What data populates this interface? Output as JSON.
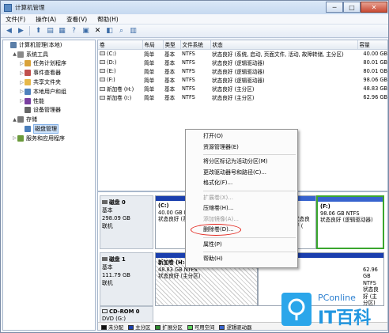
{
  "window": {
    "title": "计算机管理"
  },
  "menu": [
    "文件(F)",
    "操作(A)",
    "查看(V)",
    "帮助(H)"
  ],
  "toolbar": {
    "icons": [
      "back-icon",
      "forward-icon",
      "up-icon",
      "show-tree-icon",
      "properties-icon",
      "help-icon",
      "refresh-icon",
      "delete-icon",
      "export-icon",
      "search-icon",
      "settings-icon"
    ]
  },
  "tree": [
    {
      "label": "计算机管理(本地)",
      "indent": 0,
      "icon": "computer-icon",
      "expand": ""
    },
    {
      "label": "系统工具",
      "indent": 1,
      "icon": "tools-icon",
      "expand": "▲"
    },
    {
      "label": "任务计划程序",
      "indent": 2,
      "icon": "clock-icon",
      "expand": "▷"
    },
    {
      "label": "事件查看器",
      "indent": 2,
      "icon": "event-icon",
      "expand": "▷"
    },
    {
      "label": "共享文件夹",
      "indent": 2,
      "icon": "folder-icon",
      "expand": "▷"
    },
    {
      "label": "本地用户和组",
      "indent": 2,
      "icon": "users-icon",
      "expand": "▷"
    },
    {
      "label": "性能",
      "indent": 2,
      "icon": "performance-icon",
      "expand": "▷"
    },
    {
      "label": "设备管理器",
      "indent": 2,
      "icon": "device-icon",
      "expand": ""
    },
    {
      "label": "存储",
      "indent": 1,
      "icon": "storage-icon",
      "expand": "▲"
    },
    {
      "label": "磁盘管理",
      "indent": 2,
      "icon": "disk-icon",
      "expand": "",
      "selected": true
    },
    {
      "label": "服务和应用程序",
      "indent": 1,
      "icon": "services-icon",
      "expand": "▷"
    }
  ],
  "volume_table": {
    "headers": [
      "卷",
      "布局",
      "类型",
      "文件系统",
      "状态",
      "容量"
    ],
    "rows": [
      [
        "(C:)",
        "简单",
        "基本",
        "NTFS",
        "状态良好 (系统, 启动, 页面文件, 活动, 故障转储, 主分区)",
        "40.00 GB"
      ],
      [
        "(D:)",
        "简单",
        "基本",
        "NTFS",
        "状态良好 (逻辑驱动器)",
        "80.01 GB"
      ],
      [
        "(E:)",
        "简单",
        "基本",
        "NTFS",
        "状态良好 (逻辑驱动器)",
        "80.01 GB"
      ],
      [
        "(F:)",
        "简单",
        "基本",
        "NTFS",
        "状态良好 (逻辑驱动器)",
        "98.06 GB"
      ],
      [
        "新加卷 (H:)",
        "简单",
        "基本",
        "NTFS",
        "状态良好 (主分区)",
        "48.83 GB"
      ],
      [
        "新加卷 (I:)",
        "简单",
        "基本",
        "NTFS",
        "状态良好 (主分区)",
        "62.96 GB"
      ]
    ]
  },
  "disks": [
    {
      "name": "磁盘 0",
      "type": "基本",
      "size": "298.09 GB",
      "status": "联机",
      "partitions": [
        {
          "name": "(C:)",
          "size": "40.00 GB NTFS",
          "status": "状态良好 (系统,",
          "kind": "primary"
        },
        {
          "name": "",
          "size": "",
          "status": "",
          "kind": "hidden"
        },
        {
          "name": "",
          "size": "",
          "status": "状态良好 (",
          "kind": "logical"
        },
        {
          "name": "(F:)",
          "size": "98.06 GB NTFS",
          "status": "状态良好 (逻辑驱动器)",
          "kind": "logical-green"
        }
      ]
    },
    {
      "name": "磁盘 1",
      "type": "基本",
      "size": "111.79 GB",
      "status": "联机",
      "partitions": [
        {
          "name": "新加卷 (H:",
          "size": "48.83 GB NTFS",
          "status": "状态良好 (主分区)",
          "kind": "hatch"
        },
        {
          "name": "",
          "size": "62.96 GB NTFS",
          "status": "状态良好 (主分区)",
          "kind": "primary"
        }
      ]
    }
  ],
  "cdrom": {
    "name": "CD-ROM 0",
    "drive": "DVD (G:)"
  },
  "legend": [
    {
      "label": "未分配",
      "color": "#111111"
    },
    {
      "label": "主分区",
      "color": "#1a3fae"
    },
    {
      "label": "扩展分区",
      "color": "#2e8b2e"
    },
    {
      "label": "可用空间",
      "color": "#5fd35f"
    },
    {
      "label": "逻辑驱动器",
      "color": "#3763ce"
    }
  ],
  "context_menu": [
    {
      "label": "打开(O)",
      "disabled": false
    },
    {
      "label": "资源管理器(E)",
      "disabled": false
    },
    {
      "sep": true
    },
    {
      "label": "将分区标记为活动分区(M)",
      "disabled": false
    },
    {
      "label": "更改驱动器号和路径(C)...",
      "disabled": false
    },
    {
      "label": "格式化(F)...",
      "disabled": false
    },
    {
      "sep": true
    },
    {
      "label": "扩展卷(X)...",
      "disabled": true
    },
    {
      "label": "压缩卷(H)...",
      "disabled": false
    },
    {
      "label": "添加镜像(A)...",
      "disabled": true
    },
    {
      "label": "删除卷(D)...",
      "disabled": false,
      "highlight": true
    },
    {
      "sep": true
    },
    {
      "label": "属性(P)",
      "disabled": false
    },
    {
      "sep": true
    },
    {
      "label": "帮助(H)",
      "disabled": false
    }
  ],
  "watermark": {
    "brand": "PConline",
    "cn": "IT百科",
    "accent": "#2196e0"
  }
}
